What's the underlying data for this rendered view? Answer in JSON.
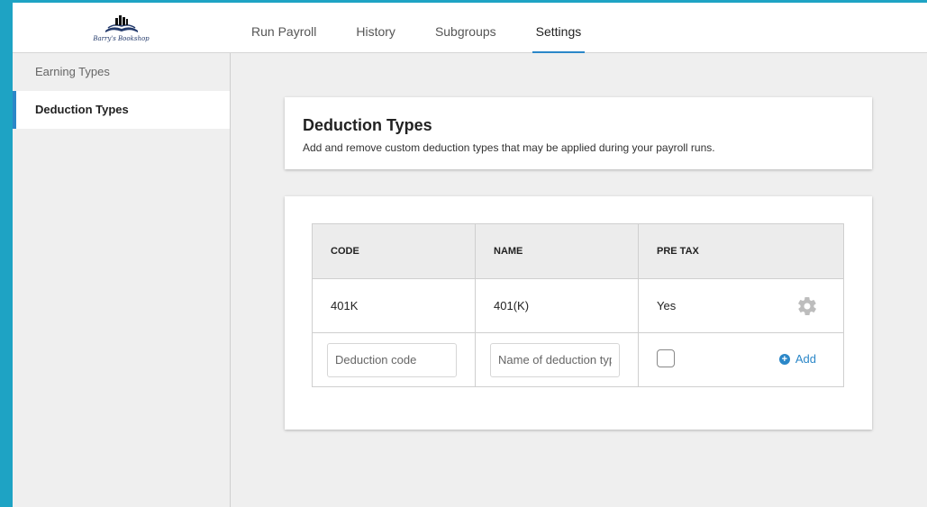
{
  "brand": {
    "name": "Barry's Bookshop",
    "logo_icon": "book-stack-logo"
  },
  "nav": {
    "tabs": [
      {
        "label": "Run Payroll"
      },
      {
        "label": "History"
      },
      {
        "label": "Subgroups"
      },
      {
        "label": "Settings",
        "active": true
      }
    ]
  },
  "sidebar": {
    "items": [
      {
        "label": "Earning Types"
      },
      {
        "label": "Deduction Types",
        "active": true
      }
    ]
  },
  "page": {
    "title": "Deduction Types",
    "subtitle": "Add and remove custom deduction types that may be applied during your payroll runs."
  },
  "table": {
    "columns": [
      "CODE",
      "NAME",
      "PRE TAX"
    ],
    "rows": [
      {
        "code": "401K",
        "name": "401(K)",
        "pre_tax": "Yes",
        "action_icon": "gear-icon"
      }
    ],
    "new_row": {
      "code_placeholder": "Deduction code",
      "name_placeholder": "Name of deduction type",
      "add_label": "Add",
      "add_icon": "plus-circle-icon"
    }
  },
  "colors": {
    "accent": "#2b87c8",
    "frame": "#1ea3c4",
    "background": "#efefef"
  }
}
